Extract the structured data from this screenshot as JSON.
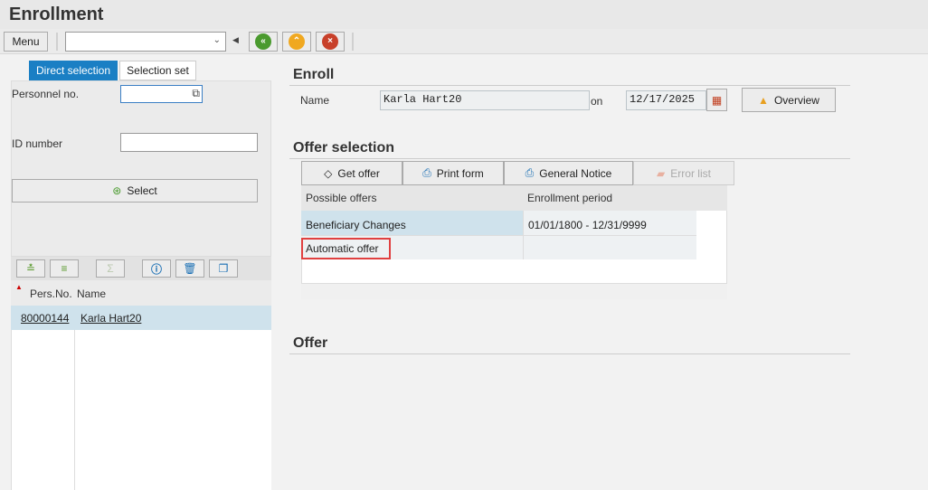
{
  "window": {
    "title": "Enrollment"
  },
  "toolbar": {
    "menu_label": "Menu",
    "command_value": ""
  },
  "left": {
    "tabs": [
      {
        "label": "Direct selection"
      },
      {
        "label": "Selection set"
      }
    ],
    "personnel_label": "Personnel no.",
    "personnel_value": "",
    "id_label": "ID number",
    "id_value": "",
    "select_label": "Select",
    "columns": [
      "Pers.No.",
      "Name"
    ],
    "rows": [
      {
        "pers_no": "80000144",
        "name": "Karla Hart20"
      }
    ]
  },
  "enroll": {
    "title": "Enroll",
    "name_label": "Name",
    "name_value": "Karla Hart20",
    "on_label": "on",
    "date_value": "12/17/2025",
    "overview_label": "Overview"
  },
  "offer_selection": {
    "title": "Offer selection",
    "buttons": [
      {
        "label": "Get offer"
      },
      {
        "label": "Print form"
      },
      {
        "label": "General Notice"
      },
      {
        "label": "Error list"
      }
    ],
    "columns": [
      "Possible offers",
      "Enrollment period"
    ],
    "rows": [
      {
        "offer": "Beneficiary Changes",
        "period": "01/01/1800 - 12/31/9999"
      },
      {
        "offer": "Automatic offer",
        "period": ""
      }
    ]
  },
  "offer": {
    "title": "Offer"
  }
}
